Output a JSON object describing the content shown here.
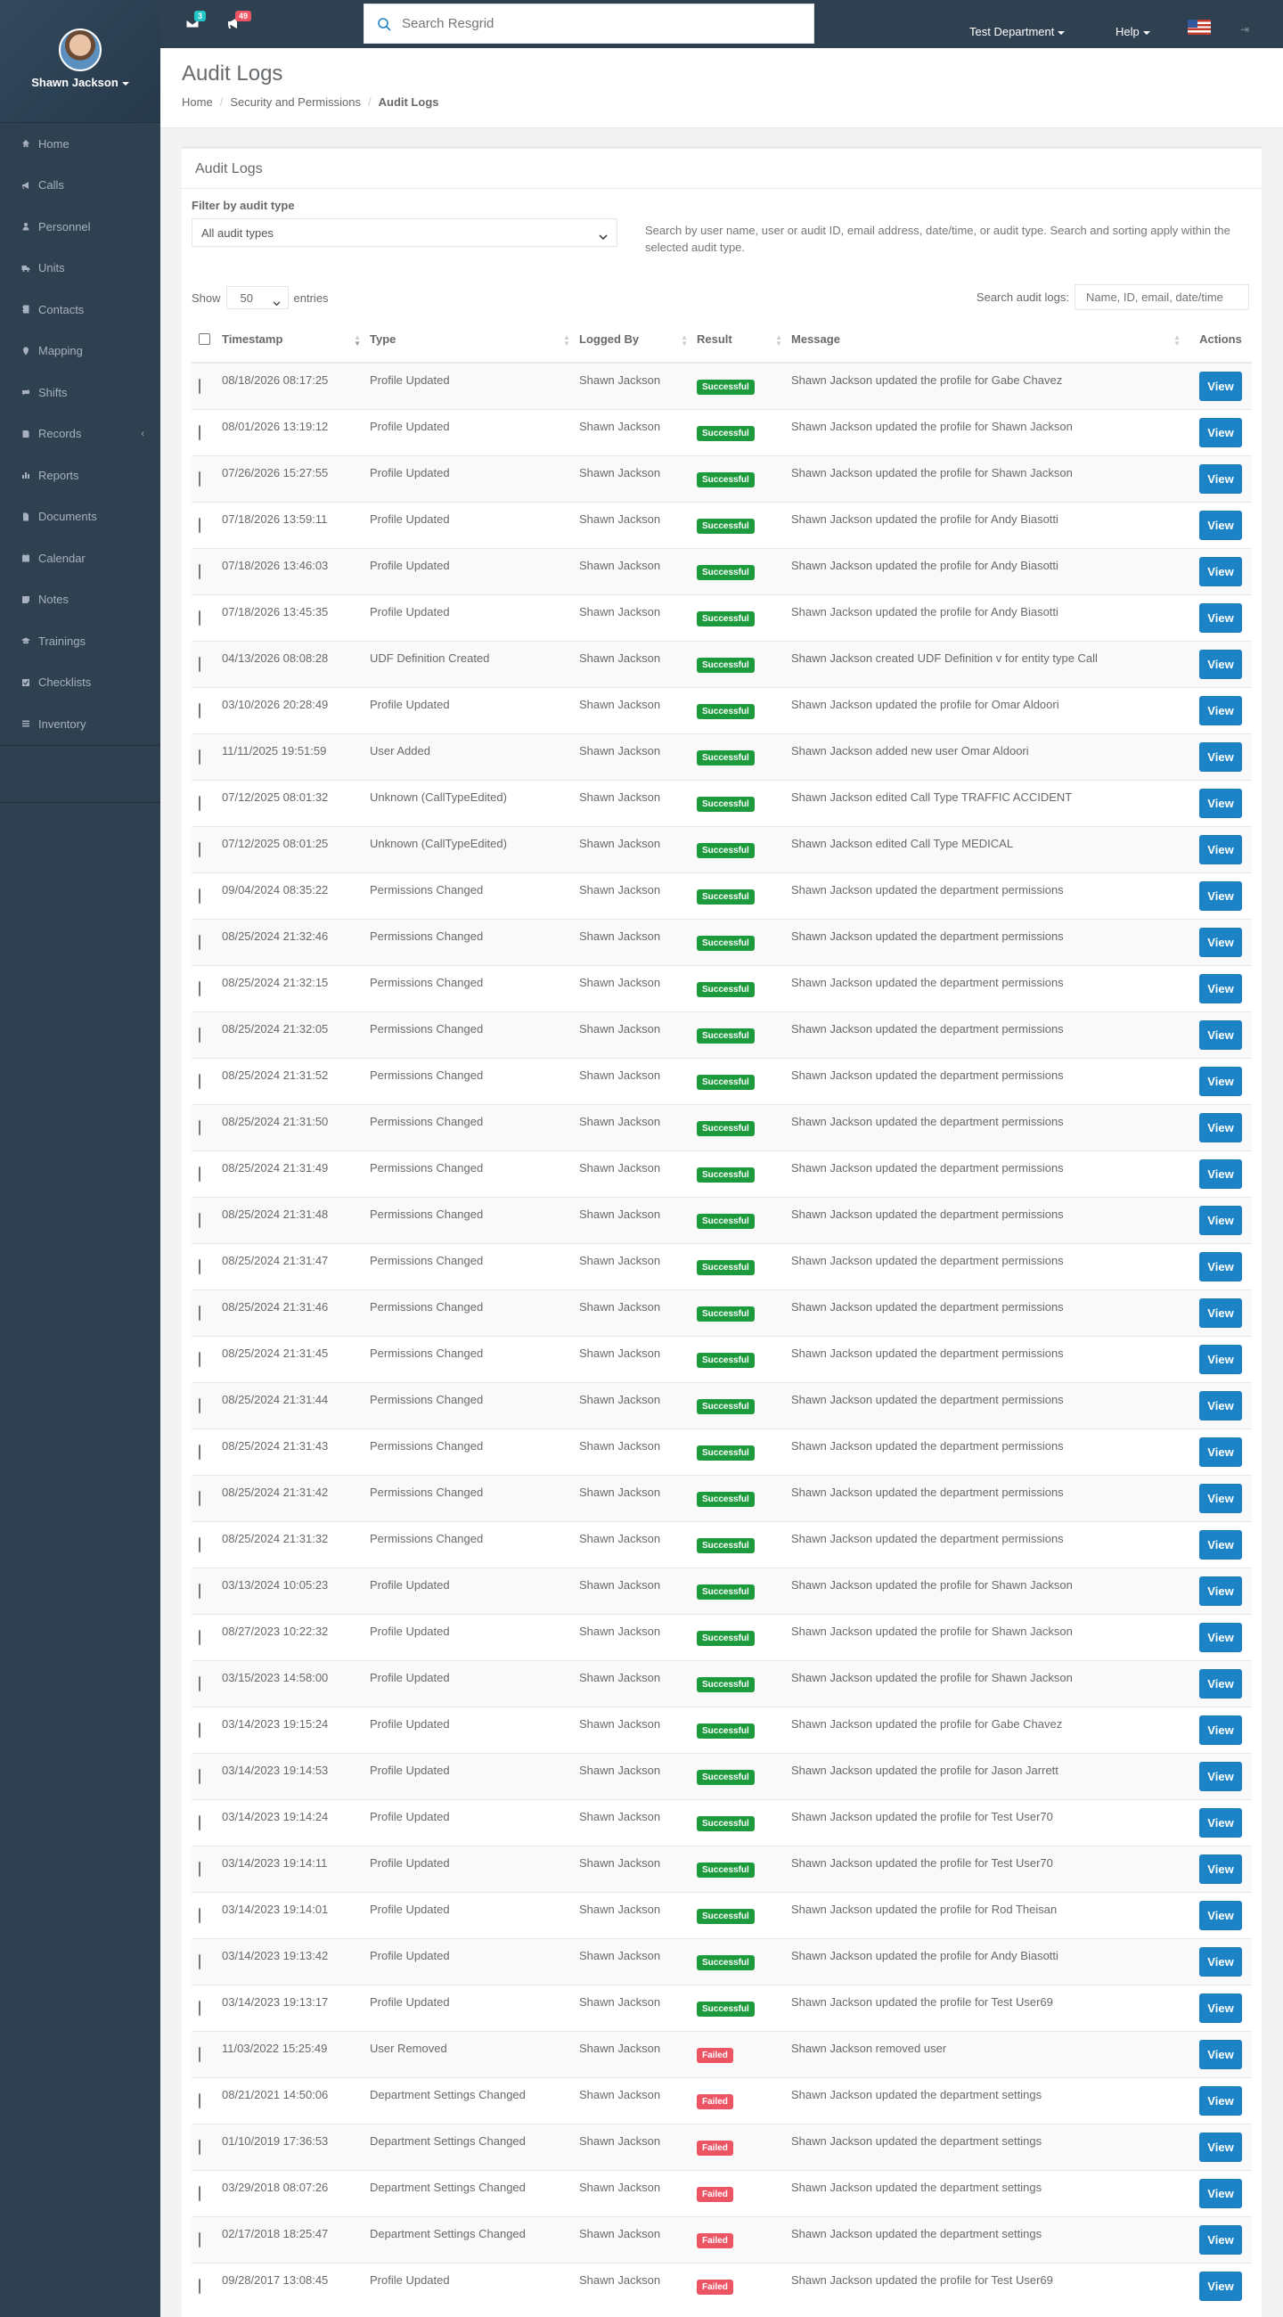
{
  "user": {
    "name": "Shawn Jackson"
  },
  "sidebar": {
    "items": [
      {
        "label": "Home",
        "icon": "home-icon"
      },
      {
        "label": "Calls",
        "icon": "bullhorn-icon"
      },
      {
        "label": "Personnel",
        "icon": "user-icon"
      },
      {
        "label": "Units",
        "icon": "truck-icon"
      },
      {
        "label": "Contacts",
        "icon": "address-book-icon"
      },
      {
        "label": "Mapping",
        "icon": "map-marker-icon"
      },
      {
        "label": "Shifts",
        "icon": "exchange-icon"
      },
      {
        "label": "Records",
        "icon": "book-icon",
        "arrow": "‹"
      },
      {
        "label": "Reports",
        "icon": "bar-chart-icon"
      },
      {
        "label": "Documents",
        "icon": "file-icon"
      },
      {
        "label": "Calendar",
        "icon": "calendar-icon"
      },
      {
        "label": "Notes",
        "icon": "sticky-note-icon"
      },
      {
        "label": "Trainings",
        "icon": "graduation-cap-icon"
      },
      {
        "label": "Checklists",
        "icon": "check-square-icon"
      },
      {
        "label": "Inventory",
        "icon": "list-icon"
      }
    ]
  },
  "topbar": {
    "messages_count": "3",
    "messages_badge_color": "#23c6c8",
    "alerts_count": "49",
    "alerts_badge_color": "#ed5565",
    "search_placeholder": "Search Resgrid",
    "department": "Test Department",
    "help": "Help"
  },
  "page": {
    "title": "Audit Logs",
    "breadcrumb": [
      "Home",
      "Security and Permissions",
      "Audit Logs"
    ]
  },
  "panel": {
    "title": "Audit Logs",
    "filter_label": "Filter by audit type",
    "filter_value": "All audit types",
    "filter_help": "Search by user name, user or audit ID, email address, date/time, or audit type. Search and sorting apply within the selected audit type.",
    "show_label": "Show",
    "show_value": "50",
    "entries_label": "entries",
    "search_label": "Search audit logs:",
    "search_placeholder": "Name, ID, email, date/time"
  },
  "table": {
    "headers": [
      "Timestamp",
      "Type",
      "Logged By",
      "Result",
      "Message",
      "Actions"
    ],
    "view_label": "View",
    "rows": [
      [
        "08/18/2026 08:17:25",
        "Profile Updated",
        "Shawn Jackson",
        "Successful",
        "Shawn Jackson updated the profile for Gabe Chavez"
      ],
      [
        "08/01/2026 13:19:12",
        "Profile Updated",
        "Shawn Jackson",
        "Successful",
        "Shawn Jackson updated the profile for Shawn Jackson"
      ],
      [
        "07/26/2026 15:27:55",
        "Profile Updated",
        "Shawn Jackson",
        "Successful",
        "Shawn Jackson updated the profile for Shawn Jackson"
      ],
      [
        "07/18/2026 13:59:11",
        "Profile Updated",
        "Shawn Jackson",
        "Successful",
        "Shawn Jackson updated the profile for Andy Biasotti"
      ],
      [
        "07/18/2026 13:46:03",
        "Profile Updated",
        "Shawn Jackson",
        "Successful",
        "Shawn Jackson updated the profile for Andy Biasotti"
      ],
      [
        "07/18/2026 13:45:35",
        "Profile Updated",
        "Shawn Jackson",
        "Successful",
        "Shawn Jackson updated the profile for Andy Biasotti"
      ],
      [
        "04/13/2026 08:08:28",
        "UDF Definition Created",
        "Shawn Jackson",
        "Successful",
        "Shawn Jackson created UDF Definition v for entity type Call"
      ],
      [
        "03/10/2026 20:28:49",
        "Profile Updated",
        "Shawn Jackson",
        "Successful",
        "Shawn Jackson updated the profile for Omar Aldoori"
      ],
      [
        "11/11/2025 19:51:59",
        "User Added",
        "Shawn Jackson",
        "Successful",
        "Shawn Jackson added new user Omar Aldoori"
      ],
      [
        "07/12/2025 08:01:32",
        "Unknown (CallTypeEdited)",
        "Shawn Jackson",
        "Successful",
        "Shawn Jackson edited Call Type TRAFFIC ACCIDENT"
      ],
      [
        "07/12/2025 08:01:25",
        "Unknown (CallTypeEdited)",
        "Shawn Jackson",
        "Successful",
        "Shawn Jackson edited Call Type MEDICAL"
      ],
      [
        "09/04/2024 08:35:22",
        "Permissions Changed",
        "Shawn Jackson",
        "Successful",
        "Shawn Jackson updated the department permissions"
      ],
      [
        "08/25/2024 21:32:46",
        "Permissions Changed",
        "Shawn Jackson",
        "Successful",
        "Shawn Jackson updated the department permissions"
      ],
      [
        "08/25/2024 21:32:15",
        "Permissions Changed",
        "Shawn Jackson",
        "Successful",
        "Shawn Jackson updated the department permissions"
      ],
      [
        "08/25/2024 21:32:05",
        "Permissions Changed",
        "Shawn Jackson",
        "Successful",
        "Shawn Jackson updated the department permissions"
      ],
      [
        "08/25/2024 21:31:52",
        "Permissions Changed",
        "Shawn Jackson",
        "Successful",
        "Shawn Jackson updated the department permissions"
      ],
      [
        "08/25/2024 21:31:50",
        "Permissions Changed",
        "Shawn Jackson",
        "Successful",
        "Shawn Jackson updated the department permissions"
      ],
      [
        "08/25/2024 21:31:49",
        "Permissions Changed",
        "Shawn Jackson",
        "Successful",
        "Shawn Jackson updated the department permissions"
      ],
      [
        "08/25/2024 21:31:48",
        "Permissions Changed",
        "Shawn Jackson",
        "Successful",
        "Shawn Jackson updated the department permissions"
      ],
      [
        "08/25/2024 21:31:47",
        "Permissions Changed",
        "Shawn Jackson",
        "Successful",
        "Shawn Jackson updated the department permissions"
      ],
      [
        "08/25/2024 21:31:46",
        "Permissions Changed",
        "Shawn Jackson",
        "Successful",
        "Shawn Jackson updated the department permissions"
      ],
      [
        "08/25/2024 21:31:45",
        "Permissions Changed",
        "Shawn Jackson",
        "Successful",
        "Shawn Jackson updated the department permissions"
      ],
      [
        "08/25/2024 21:31:44",
        "Permissions Changed",
        "Shawn Jackson",
        "Successful",
        "Shawn Jackson updated the department permissions"
      ],
      [
        "08/25/2024 21:31:43",
        "Permissions Changed",
        "Shawn Jackson",
        "Successful",
        "Shawn Jackson updated the department permissions"
      ],
      [
        "08/25/2024 21:31:42",
        "Permissions Changed",
        "Shawn Jackson",
        "Successful",
        "Shawn Jackson updated the department permissions"
      ],
      [
        "08/25/2024 21:31:32",
        "Permissions Changed",
        "Shawn Jackson",
        "Successful",
        "Shawn Jackson updated the department permissions"
      ],
      [
        "03/13/2024 10:05:23",
        "Profile Updated",
        "Shawn Jackson",
        "Successful",
        "Shawn Jackson updated the profile for Shawn Jackson"
      ],
      [
        "08/27/2023 10:22:32",
        "Profile Updated",
        "Shawn Jackson",
        "Successful",
        "Shawn Jackson updated the profile for Shawn Jackson"
      ],
      [
        "03/15/2023 14:58:00",
        "Profile Updated",
        "Shawn Jackson",
        "Successful",
        "Shawn Jackson updated the profile for Shawn Jackson"
      ],
      [
        "03/14/2023 19:15:24",
        "Profile Updated",
        "Shawn Jackson",
        "Successful",
        "Shawn Jackson updated the profile for Gabe Chavez"
      ],
      [
        "03/14/2023 19:14:53",
        "Profile Updated",
        "Shawn Jackson",
        "Successful",
        "Shawn Jackson updated the profile for Jason Jarrett"
      ],
      [
        "03/14/2023 19:14:24",
        "Profile Updated",
        "Shawn Jackson",
        "Successful",
        "Shawn Jackson updated the profile for Test User70"
      ],
      [
        "03/14/2023 19:14:11",
        "Profile Updated",
        "Shawn Jackson",
        "Successful",
        "Shawn Jackson updated the profile for Test User70"
      ],
      [
        "03/14/2023 19:14:01",
        "Profile Updated",
        "Shawn Jackson",
        "Successful",
        "Shawn Jackson updated the profile for Rod Theisan"
      ],
      [
        "03/14/2023 19:13:42",
        "Profile Updated",
        "Shawn Jackson",
        "Successful",
        "Shawn Jackson updated the profile for Andy Biasotti"
      ],
      [
        "03/14/2023 19:13:17",
        "Profile Updated",
        "Shawn Jackson",
        "Successful",
        "Shawn Jackson updated the profile for Test User69"
      ],
      [
        "11/03/2022 15:25:49",
        "User Removed",
        "Shawn Jackson",
        "Failed",
        "Shawn Jackson removed user"
      ],
      [
        "08/21/2021 14:50:06",
        "Department Settings Changed",
        "Shawn Jackson",
        "Failed",
        "Shawn Jackson updated the department settings"
      ],
      [
        "01/10/2019 17:36:53",
        "Department Settings Changed",
        "Shawn Jackson",
        "Failed",
        "Shawn Jackson updated the department settings"
      ],
      [
        "03/29/2018 08:07:26",
        "Department Settings Changed",
        "Shawn Jackson",
        "Failed",
        "Shawn Jackson updated the department settings"
      ],
      [
        "02/17/2018 18:25:47",
        "Department Settings Changed",
        "Shawn Jackson",
        "Failed",
        "Shawn Jackson updated the department settings"
      ],
      [
        "09/28/2017 13:08:45",
        "Profile Updated",
        "Shawn Jackson",
        "Failed",
        "Shawn Jackson updated the profile for Test User69"
      ]
    ]
  }
}
